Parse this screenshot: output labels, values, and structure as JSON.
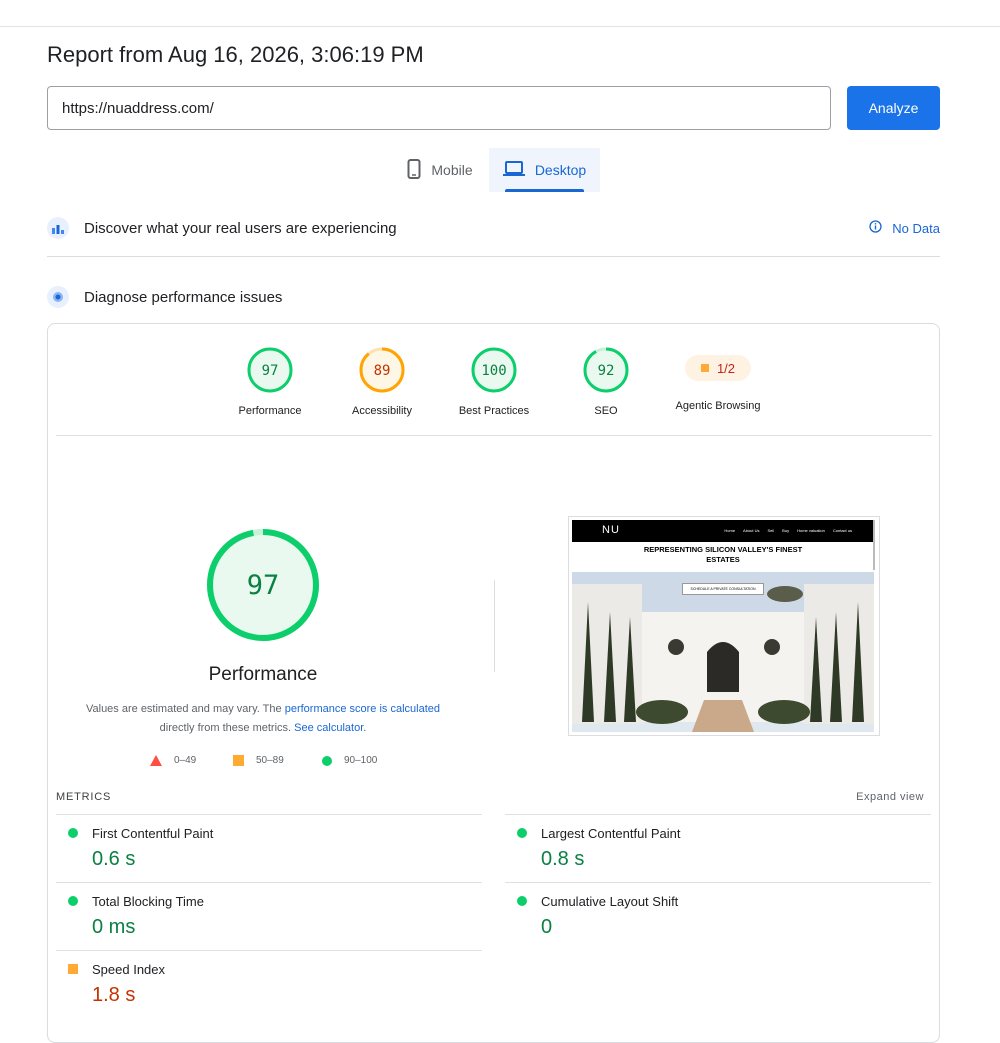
{
  "report": {
    "title": "Report from Aug 16, 2026, 3:06:19 PM"
  },
  "url_input": {
    "value": "https://nuaddress.com/"
  },
  "analyze_label": "Analyze",
  "tabs": [
    {
      "label": "Mobile"
    },
    {
      "label": "Desktop"
    }
  ],
  "crux": {
    "title": "Discover what your real users are experiencing",
    "status": "No Data"
  },
  "diagnose": {
    "title": "Diagnose performance issues"
  },
  "gauges": [
    {
      "label": "Performance",
      "score": "97",
      "color": "#0cce6b"
    },
    {
      "label": "Accessibility",
      "score": "89",
      "color": "#ffa400"
    },
    {
      "label": "Best Practices",
      "score": "100",
      "color": "#0cce6b"
    },
    {
      "label": "SEO",
      "score": "92",
      "color": "#0cce6b"
    },
    {
      "label": "Agentic Browsing",
      "score": "1/2",
      "color": "#ffa400"
    }
  ],
  "performance": {
    "score": "97",
    "label": "Performance",
    "note_pre": "Values are estimated and may vary. The ",
    "note_link1": "performance score is calculated",
    "note_mid": "directly from these metrics. ",
    "note_link2": "See calculator."
  },
  "legend": [
    {
      "range": "0–49"
    },
    {
      "range": "50–89"
    },
    {
      "range": "90–100"
    }
  ],
  "screenshot": {
    "logo": "NU",
    "nav": [
      "Home",
      "About Us",
      "Sell",
      "Buy",
      "Home valuation",
      "Contact us"
    ],
    "headline_1": "REPRESENTING SILICON VALLEY'S FINEST",
    "headline_2": "ESTATES",
    "cta": "SCHEDULE A PRIVATE CONSULTATION"
  },
  "metrics": {
    "heading": "METRICS",
    "expand": "Expand view",
    "items": [
      {
        "name": "First Contentful Paint",
        "value": "0.6 s"
      },
      {
        "name": "Largest Contentful Paint",
        "value": "0.8 s"
      },
      {
        "name": "Total Blocking Time",
        "value": "0 ms"
      },
      {
        "name": "Cumulative Layout Shift",
        "value": "0"
      },
      {
        "name": "Speed Index",
        "value": "1.8 s"
      }
    ]
  },
  "colors": {
    "accent": "#1a73e8",
    "pass": "#0cce6b",
    "average": "#ffa400",
    "fail": "#ff4e42"
  }
}
